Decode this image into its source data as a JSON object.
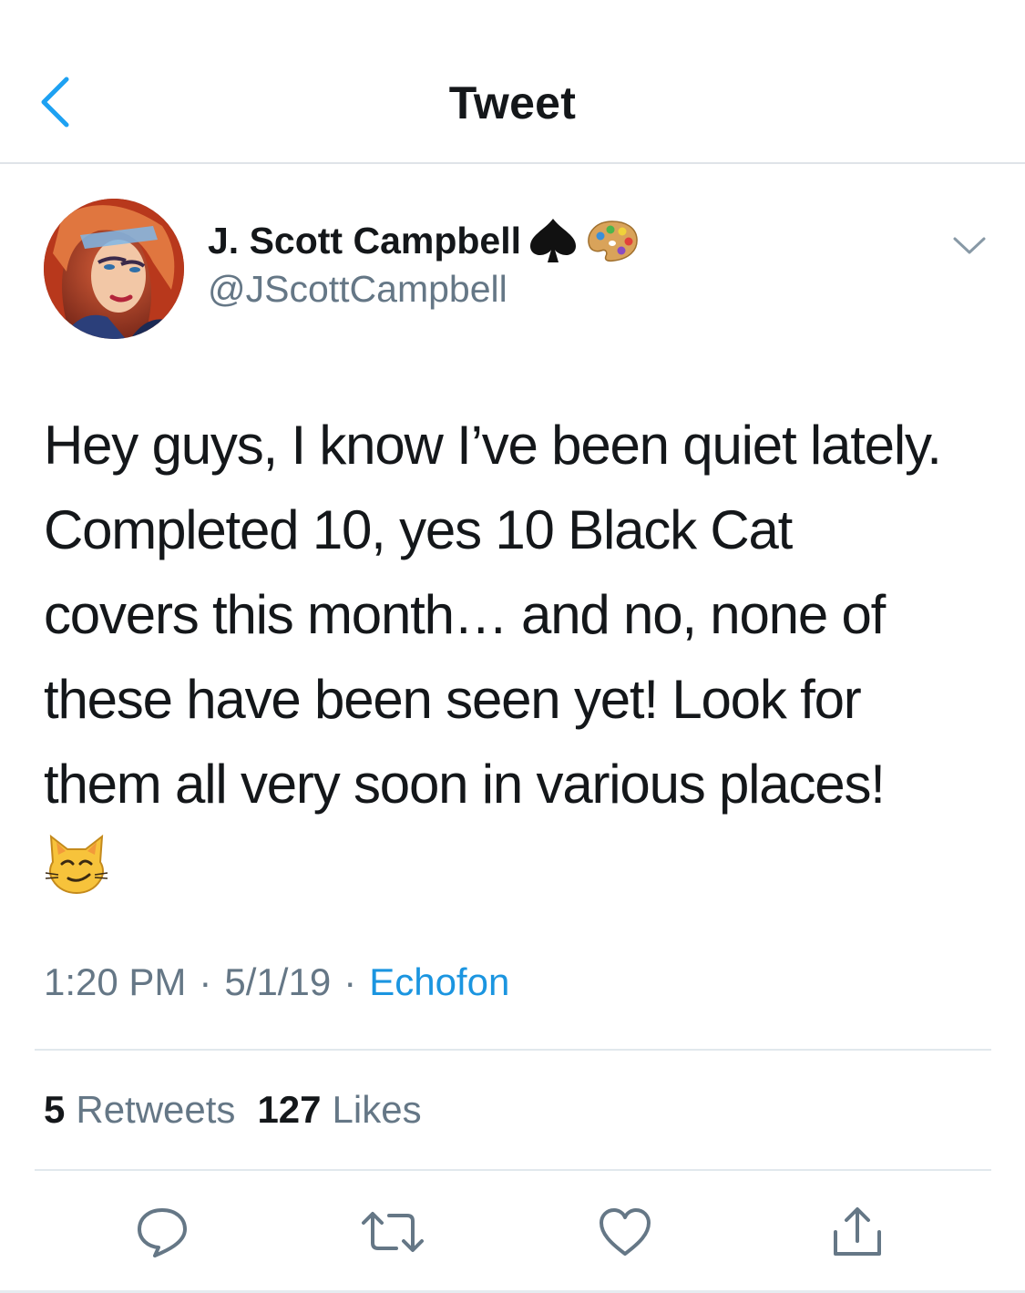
{
  "header": {
    "title": "Tweet",
    "back_icon": "chevron-left-icon"
  },
  "tweet": {
    "author": {
      "display_name": "J. Scott Campbell",
      "handle": "@JScottCampbell",
      "name_emojis": [
        "spade-suit-icon",
        "artist-palette-icon"
      ]
    },
    "text_lines": [
      "Hey guys, I know I’ve been quiet lately.",
      "Completed 10, yes 10 Black Cat",
      "covers this month… and no, none of",
      "these have been seen yet! Look for",
      "them all very soon in various places!"
    ],
    "text_emoji": "smirking-cat-icon",
    "time": "1:20 PM",
    "date": "5/1/19",
    "separator": "·",
    "source": "Echofon",
    "stats": {
      "retweets_count": "5",
      "retweets_label": "Retweets",
      "likes_count": "127",
      "likes_label": "Likes"
    }
  },
  "actions": [
    "reply-icon",
    "retweet-icon",
    "like-icon",
    "share-icon"
  ],
  "colors": {
    "accent": "#1da1f2",
    "link": "#1b95e0",
    "text_primary": "#14171a",
    "text_secondary": "#657786",
    "divider": "#e1e8ed"
  }
}
